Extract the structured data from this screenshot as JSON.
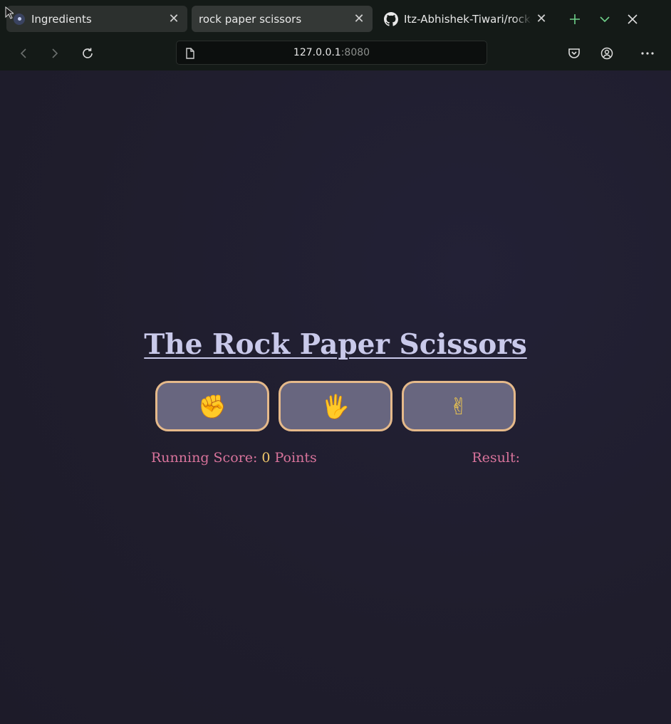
{
  "browser": {
    "tabs": [
      {
        "title": "Ingredients",
        "close": "✕",
        "active": false
      },
      {
        "title": "rock paper scissors",
        "close": "✕",
        "active": true
      },
      {
        "title": "Itz-Abhishek-Tiwari/rock-paper-scissors",
        "close": "✕",
        "active": false
      }
    ],
    "new_tab_icon": "plus-icon",
    "list_tabs_icon": "chevron-down-icon",
    "close_window_icon": "close-icon",
    "url_host": "127.0.0.1",
    "url_port": ":8080",
    "accent": "#6fd08a"
  },
  "game": {
    "title": "The Rock Paper Scissors",
    "choices": [
      {
        "name": "rock",
        "glyph": "✊"
      },
      {
        "name": "paper",
        "glyph": "🖐"
      },
      {
        "name": "scissors",
        "glyph": "✌"
      }
    ],
    "score_label": "Running Score:",
    "score_value": "0",
    "score_unit": "Points",
    "result_label": "Result:",
    "colors": {
      "button_fill": "#68667f",
      "button_border": "#e5b98a",
      "score_text": "#d8739b",
      "title": "#c9c9ea"
    }
  }
}
